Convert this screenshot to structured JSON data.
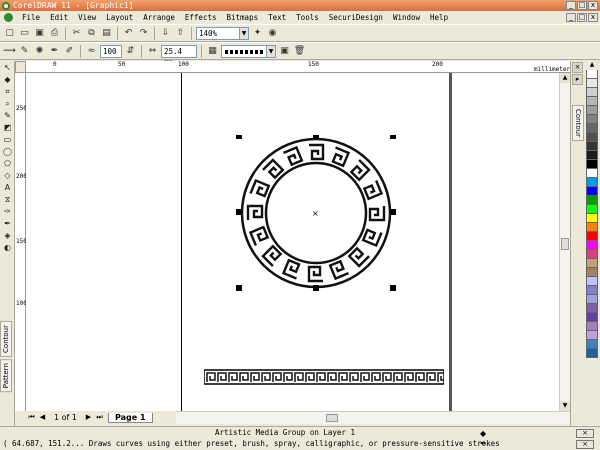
{
  "window": {
    "title": "CorelDRAW 11 - [Graphic1]",
    "controls": [
      "_",
      "□",
      "x"
    ]
  },
  "menubar": {
    "items": [
      "File",
      "Edit",
      "View",
      "Layout",
      "Arrange",
      "Effects",
      "Bitmaps",
      "Text",
      "Tools",
      "SecuriDesign",
      "Window",
      "Help"
    ],
    "doc_controls": [
      "_",
      "□",
      "x"
    ]
  },
  "toolbar_standard": {
    "zoom_value": "140%"
  },
  "toolbar_property": {
    "smoothness_value": "100",
    "width_value": "25.4 mm"
  },
  "rulers": {
    "h_labels": [
      "0",
      "50",
      "100",
      "150",
      "200"
    ],
    "v_labels": [
      "250",
      "200",
      "150",
      "100"
    ],
    "units": "millimeters"
  },
  "right_docker": {
    "tab_label": "Contour"
  },
  "left_dockers": {
    "tabs": [
      "Contour",
      "Pattern"
    ]
  },
  "palette": {
    "colors": [
      "#ffffff",
      "#e8e8e8",
      "#cfcfcf",
      "#b5b5b5",
      "#9c9c9c",
      "#828282",
      "#686868",
      "#4f4f4f",
      "#353535",
      "#1c1c1c",
      "#000000",
      "#ffffff",
      "#00a0e0",
      "#0000ff",
      "#00a000",
      "#00ff00",
      "#ffff00",
      "#ff8000",
      "#ff0000",
      "#ff00ff",
      "#e04080",
      "#c0a080",
      "#a08060",
      "#c0c0ff",
      "#8080c0",
      "#a0a0e0",
      "#8060a0",
      "#6040a0",
      "#a080c0",
      "#c0a0e0",
      "#4080c0",
      "#2060a0"
    ]
  },
  "page_nav": {
    "counter": "1 of 1",
    "page_tab": "Page 1"
  },
  "status": {
    "selection_info": "Artistic Media Group on Layer 1",
    "coords_hint": "( 64.687, 151.2... Draws curves using either preset, brush, spray, calligraphic, or pressure-sensitive strokes"
  }
}
